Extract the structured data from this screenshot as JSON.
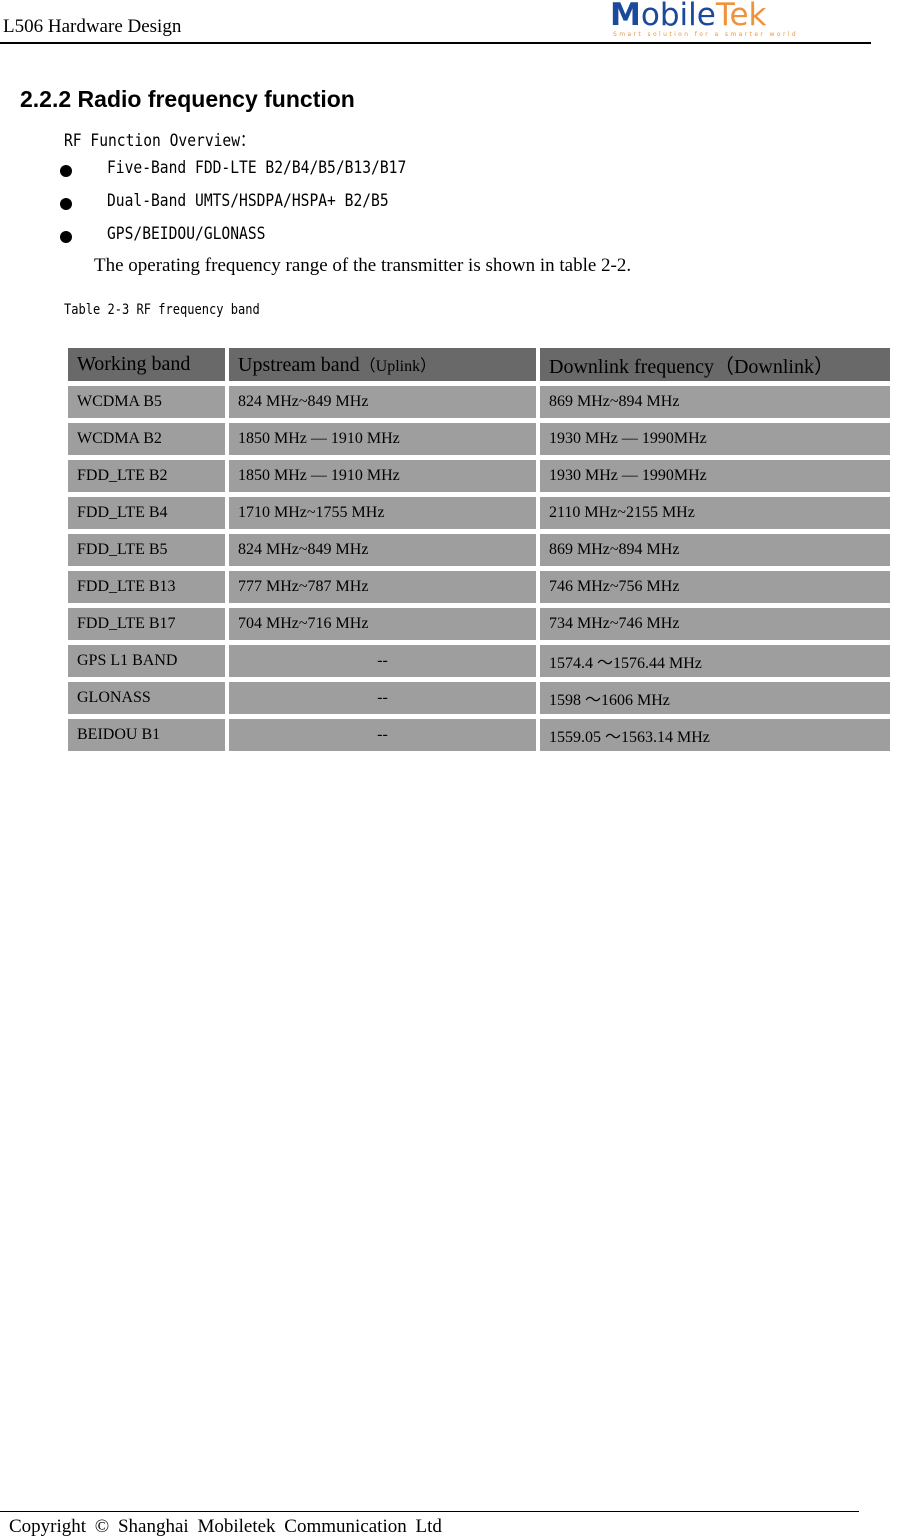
{
  "header": {
    "doc_title": "L506 Hardware Design",
    "logo": {
      "brand_part1": "M",
      "brand_part2": "obile",
      "brand_part3": "Tek",
      "tagline": "Smart solution for a smarter world",
      "colors": {
        "blue": "#1b4a9c",
        "orange": "#f0923a"
      }
    }
  },
  "section": {
    "title": "2.2.2 Radio frequency function",
    "overview_label": "RF Function Overview：",
    "bullets": [
      "Five-Band FDD-LTE B2/B4/B5/B13/B17",
      "Dual-Band UMTS/HSDPA/HSPA+ B2/B5",
      "GPS/BEIDOU/GLONASS"
    ],
    "paragraph": "The operating frequency range of the transmitter is shown in table 2-2.",
    "table_caption": "Table 2-3 RF frequency band"
  },
  "table": {
    "headers": {
      "col1": "Working band",
      "col2_main": "Upstream band",
      "col2_sub": "（Uplink）",
      "col3": "Downlink frequency（Downlink）"
    },
    "rows": [
      {
        "band": "WCDMA B5",
        "uplink": "824 MHz~849 MHz",
        "downlink": "869 MHz~894 MHz"
      },
      {
        "band": "WCDMA B2",
        "uplink": "1850 MHz — 1910 MHz",
        "downlink": "1930 MHz — 1990MHz"
      },
      {
        "band": "FDD_LTE B2",
        "uplink": "1850 MHz — 1910 MHz",
        "downlink": "1930 MHz — 1990MHz"
      },
      {
        "band": "FDD_LTE B4",
        "uplink": "1710 MHz~1755 MHz",
        "downlink": "2110 MHz~2155 MHz"
      },
      {
        "band": "FDD_LTE B5",
        "uplink": "824 MHz~849 MHz",
        "downlink": "869 MHz~894 MHz"
      },
      {
        "band": "FDD_LTE B13",
        "uplink": "777 MHz~787 MHz",
        "downlink": "746 MHz~756 MHz"
      },
      {
        "band": "FDD_LTE B17",
        "uplink": "704 MHz~716 MHz",
        "downlink": "734 MHz~746 MHz"
      },
      {
        "band": "GPS L1 BAND",
        "uplink": "--",
        "downlink": "1574.4 ～1576.44 MHz"
      },
      {
        "band": "GLONASS",
        "uplink": "--",
        "downlink": "1598 ～1606 MHz"
      },
      {
        "band": "BEIDOU B1",
        "uplink": "--",
        "downlink": "1559.05 ～1563.14 MHz"
      }
    ]
  },
  "footer": {
    "copyright": "Copyright © Shanghai Mobiletek Communication Ltd"
  }
}
